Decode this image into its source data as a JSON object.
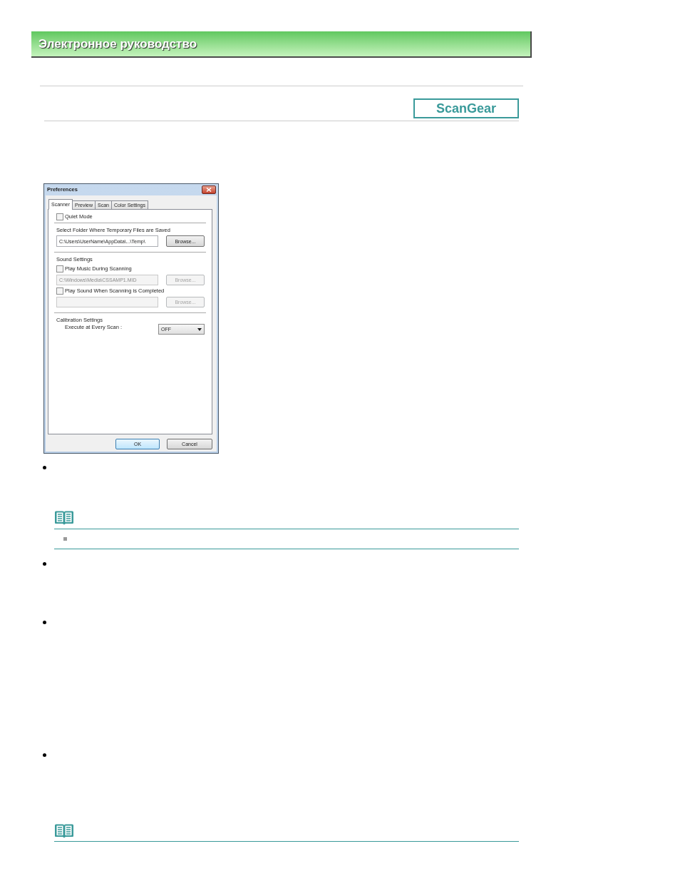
{
  "header": {
    "title": "Электронное руководство"
  },
  "product_label": "ScanGear",
  "dialog": {
    "title": "Preferences",
    "tabs": [
      {
        "label": "Scanner",
        "selected": true
      },
      {
        "label": "Preview",
        "selected": false
      },
      {
        "label": "Scan",
        "selected": false
      },
      {
        "label": "Color Settings",
        "selected": false
      }
    ],
    "quiet_mode": {
      "label": "Quiet Mode",
      "checked": false
    },
    "temp_folder": {
      "label": "Select Folder Where Temporary Files are Saved",
      "value": "C:\\Users\\UserName\\AppData\\...\\Temp\\",
      "browse": "Browse...",
      "disabled": false
    },
    "sound_settings": {
      "label": "Sound Settings",
      "options": [
        {
          "label": "Play Music During Scanning",
          "checked": false,
          "value": "C:\\Windows\\Media\\CSSAMP1.MID",
          "browse": "Browse...",
          "disabled": true
        },
        {
          "label": "Play Sound When Scanning is Completed",
          "checked": false,
          "browse": "Browse...",
          "disabled": true
        }
      ]
    },
    "calibration": {
      "label": "Calibration Settings",
      "field_label": "Execute at Every Scan :",
      "value": "OFF"
    },
    "buttons": [
      {
        "label": "OK",
        "default": true
      },
      {
        "label": "Cancel",
        "default": false
      }
    ]
  }
}
